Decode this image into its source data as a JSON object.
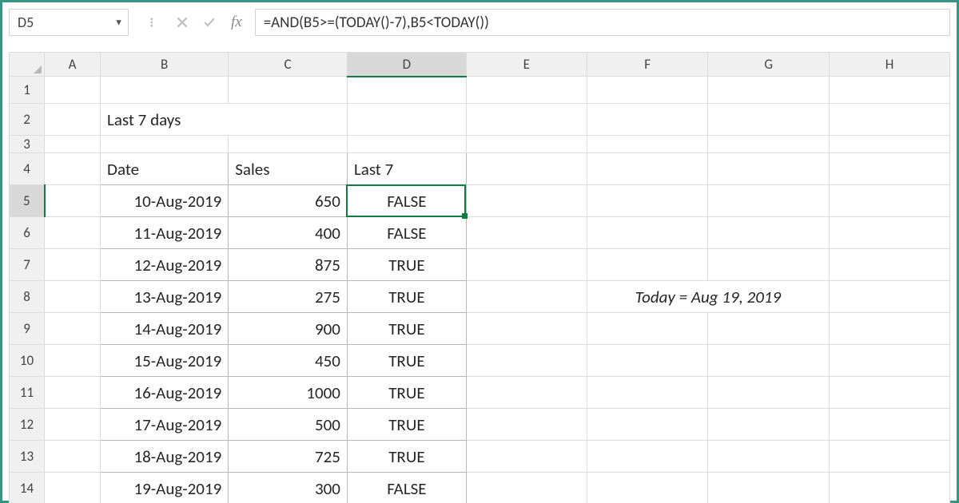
{
  "name_box": "D5",
  "formula": "=AND(B5>=(TODAY()-7),B5<TODAY())",
  "columns": [
    "A",
    "B",
    "C",
    "D",
    "E",
    "F",
    "G",
    "H"
  ],
  "title": "Last 7 days",
  "headers": {
    "date": "Date",
    "sales": "Sales",
    "last7": "Last 7"
  },
  "note": "Today = Aug 19, 2019",
  "rows": [
    {
      "n": 5,
      "date": "10-Aug-2019",
      "sales": 650,
      "last7": "FALSE"
    },
    {
      "n": 6,
      "date": "11-Aug-2019",
      "sales": 400,
      "last7": "FALSE"
    },
    {
      "n": 7,
      "date": "12-Aug-2019",
      "sales": 875,
      "last7": "TRUE"
    },
    {
      "n": 8,
      "date": "13-Aug-2019",
      "sales": 275,
      "last7": "TRUE"
    },
    {
      "n": 9,
      "date": "14-Aug-2019",
      "sales": 900,
      "last7": "TRUE"
    },
    {
      "n": 10,
      "date": "15-Aug-2019",
      "sales": 450,
      "last7": "TRUE"
    },
    {
      "n": 11,
      "date": "16-Aug-2019",
      "sales": 1000,
      "last7": "TRUE"
    },
    {
      "n": 12,
      "date": "17-Aug-2019",
      "sales": 500,
      "last7": "TRUE"
    },
    {
      "n": 13,
      "date": "18-Aug-2019",
      "sales": 725,
      "last7": "TRUE"
    },
    {
      "n": 14,
      "date": "19-Aug-2019",
      "sales": 300,
      "last7": "FALSE"
    }
  ],
  "active_cell": "D5"
}
